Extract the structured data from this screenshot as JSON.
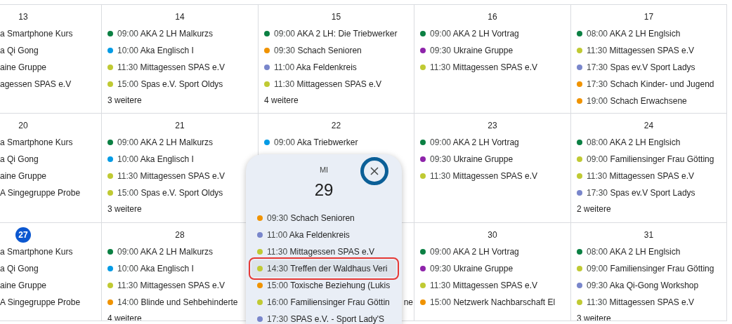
{
  "weeks": [
    {
      "days": [
        {
          "day": "13",
          "today": false,
          "events": [
            {
              "kind": "clipped",
              "text": "a Smartphone Kurs"
            },
            {
              "kind": "clipped",
              "text": "a Qi Gong"
            },
            {
              "kind": "clipped",
              "text": "aine Gruppe"
            },
            {
              "kind": "clipped",
              "text": "agessen SPAS e.V"
            }
          ]
        },
        {
          "day": "14",
          "today": false,
          "events": [
            {
              "kind": "event",
              "time": "09:00",
              "title": "AKA 2 LH Malkurzs",
              "color": "#0b8043"
            },
            {
              "kind": "event",
              "time": "10:00",
              "title": "Aka Englisch I",
              "color": "#039be5"
            },
            {
              "kind": "event",
              "time": "11:30",
              "title": "Mittagessen SPAS e.V",
              "color": "#c0ca33"
            },
            {
              "kind": "event",
              "time": "15:00",
              "title": "Spas e.V. Sport Oldys",
              "color": "#c0ca33"
            }
          ],
          "more": "3 weitere"
        },
        {
          "day": "15",
          "today": false,
          "events": [
            {
              "kind": "event",
              "time": "09:00",
              "title": "AKA 2 LH: Die Triebwerker",
              "color": "#0b8043"
            },
            {
              "kind": "event",
              "time": "09:30",
              "title": "Schach Senioren",
              "color": "#f09300"
            },
            {
              "kind": "event",
              "time": "11:00",
              "title": "Aka Feldenkreis",
              "color": "#7986cb"
            },
            {
              "kind": "event",
              "time": "11:30",
              "title": "Mittagessen SPAS e.V",
              "color": "#c0ca33"
            }
          ],
          "more": "4 weitere"
        },
        {
          "day": "16",
          "today": false,
          "events": [
            {
              "kind": "event",
              "time": "09:00",
              "title": "AKA 2 LH Vortrag",
              "color": "#0b8043"
            },
            {
              "kind": "event",
              "time": "09:30",
              "title": "Ukraine Gruppe",
              "color": "#8e24aa"
            },
            {
              "kind": "event",
              "time": "11:30",
              "title": "Mittagessen SPAS e.V",
              "color": "#c0ca33"
            }
          ]
        },
        {
          "day": "17",
          "today": false,
          "events": [
            {
              "kind": "event",
              "time": "08:00",
              "title": "AKA 2 LH Englsich",
              "color": "#0b8043"
            },
            {
              "kind": "event",
              "time": "11:30",
              "title": "Mittagessen SPAS e.V",
              "color": "#c0ca33"
            },
            {
              "kind": "event",
              "time": "17:30",
              "title": "Spas ev.V Sport Ladys",
              "color": "#7986cb"
            },
            {
              "kind": "event",
              "time": "17:30",
              "title": "Schach Kinder- und Jugend",
              "color": "#f09300"
            },
            {
              "kind": "event",
              "time": "19:00",
              "title": "Schach Erwachsene",
              "color": "#f09300"
            }
          ]
        }
      ]
    },
    {
      "days": [
        {
          "day": "20",
          "today": false,
          "events": [
            {
              "kind": "clipped",
              "text": "a Smartphone Kurs"
            },
            {
              "kind": "clipped",
              "text": "a Qi Gong"
            },
            {
              "kind": "clipped",
              "text": "aine Gruppe"
            },
            {
              "kind": "clipped",
              "text": "A Singegruppe Probe"
            }
          ]
        },
        {
          "day": "21",
          "today": false,
          "events": [
            {
              "kind": "event",
              "time": "09:00",
              "title": "AKA 2 LH Malkurzs",
              "color": "#0b8043"
            },
            {
              "kind": "event",
              "time": "10:00",
              "title": "Aka Englisch I",
              "color": "#039be5"
            },
            {
              "kind": "event",
              "time": "11:30",
              "title": "Mittagessen SPAS e.V",
              "color": "#c0ca33"
            },
            {
              "kind": "event",
              "time": "15:00",
              "title": "Spas e.V. Sport Oldys",
              "color": "#c0ca33"
            }
          ],
          "more": "3 weitere"
        },
        {
          "day": "22",
          "today": false,
          "events": [
            {
              "kind": "event",
              "time": "09:00",
              "title": "Aka Triebwerker",
              "color": "#039be5"
            }
          ]
        },
        {
          "day": "23",
          "today": false,
          "events": [
            {
              "kind": "event",
              "time": "09:00",
              "title": "AKA 2 LH Vortrag",
              "color": "#0b8043"
            },
            {
              "kind": "event",
              "time": "09:30",
              "title": "Ukraine Gruppe",
              "color": "#8e24aa"
            },
            {
              "kind": "event",
              "time": "11:30",
              "title": "Mittagessen SPAS e.V",
              "color": "#c0ca33"
            }
          ]
        },
        {
          "day": "24",
          "today": false,
          "events": [
            {
              "kind": "event",
              "time": "08:00",
              "title": "AKA 2 LH Englsich",
              "color": "#0b8043"
            },
            {
              "kind": "event",
              "time": "09:00",
              "title": "Familiensinger Frau Götting",
              "color": "#c0ca33"
            },
            {
              "kind": "event",
              "time": "11:30",
              "title": "Mittagessen SPAS e.V",
              "color": "#c0ca33"
            },
            {
              "kind": "event",
              "time": "17:30",
              "title": "Spas ev.V Sport Ladys",
              "color": "#7986cb"
            }
          ],
          "more": "2 weitere"
        }
      ]
    },
    {
      "days": [
        {
          "day": "27",
          "today": true,
          "events": [
            {
              "kind": "clipped",
              "text": "a Smartphone Kurs"
            },
            {
              "kind": "clipped",
              "text": "a Qi Gong"
            },
            {
              "kind": "clipped",
              "text": "aine Gruppe"
            },
            {
              "kind": "clipped",
              "text": "A Singegruppe Probe"
            }
          ]
        },
        {
          "day": "28",
          "today": false,
          "events": [
            {
              "kind": "event",
              "time": "09:00",
              "title": "AKA 2 LH Malkurzs",
              "color": "#0b8043"
            },
            {
              "kind": "event",
              "time": "10:00",
              "title": "Aka Englisch I",
              "color": "#039be5"
            },
            {
              "kind": "event",
              "time": "11:30",
              "title": "Mittagessen SPAS e.V",
              "color": "#c0ca33"
            },
            {
              "kind": "event",
              "time": "14:00",
              "title": "Blinde und Sehbehinderte",
              "color": "#f09300"
            }
          ],
          "more": "4 weitere"
        },
        {
          "events": [
            {
              "kind": "fragment",
              "text": "ne"
            }
          ]
        },
        {
          "day": "30",
          "today": false,
          "events": [
            {
              "kind": "event",
              "time": "09:00",
              "title": "AKA 2 LH Vortrag",
              "color": "#0b8043"
            },
            {
              "kind": "event",
              "time": "09:30",
              "title": "Ukraine Gruppe",
              "color": "#8e24aa"
            },
            {
              "kind": "event",
              "time": "11:30",
              "title": "Mittagessen SPAS e.V",
              "color": "#c0ca33"
            },
            {
              "kind": "event",
              "time": "15:00",
              "title": "Netzwerk Nachbarschaft El",
              "color": "#f09300"
            }
          ]
        },
        {
          "day": "31",
          "today": false,
          "events": [
            {
              "kind": "event",
              "time": "08:00",
              "title": "AKA 2 LH Englsich",
              "color": "#0b8043"
            },
            {
              "kind": "event",
              "time": "09:00",
              "title": "Familiensinger Frau Götting",
              "color": "#c0ca33"
            },
            {
              "kind": "event",
              "time": "09:30",
              "title": "Aka Qi-Gong Workshop",
              "color": "#7986cb"
            },
            {
              "kind": "event",
              "time": "11:30",
              "title": "Mittagessen SPAS e.V",
              "color": "#c0ca33"
            }
          ],
          "more": "3 weitere"
        }
      ]
    }
  ],
  "popup": {
    "weekday": "MI",
    "day": "29",
    "events": [
      {
        "time": "09:30",
        "title": "Schach Senioren",
        "color": "#f09300",
        "selected": false
      },
      {
        "time": "11:00",
        "title": "Aka Feldenkreis",
        "color": "#7986cb",
        "selected": false
      },
      {
        "time": "11:30",
        "title": "Mittagessen SPAS e.V",
        "color": "#c0ca33",
        "selected": false
      },
      {
        "time": "14:30",
        "title": "Treffen der Waldhaus Veri",
        "color": "#c0ca33",
        "selected": true
      },
      {
        "time": "15:00",
        "title": "Toxische Beziehung (Lukis",
        "color": "#f09300",
        "selected": false
      },
      {
        "time": "16:00",
        "title": "Familiensinger Frau Göttin",
        "color": "#c0ca33",
        "selected": false
      },
      {
        "time": "17:30",
        "title": "SPAS e.V. - Sport Lady'S",
        "color": "#7986cb",
        "selected": false
      }
    ]
  }
}
